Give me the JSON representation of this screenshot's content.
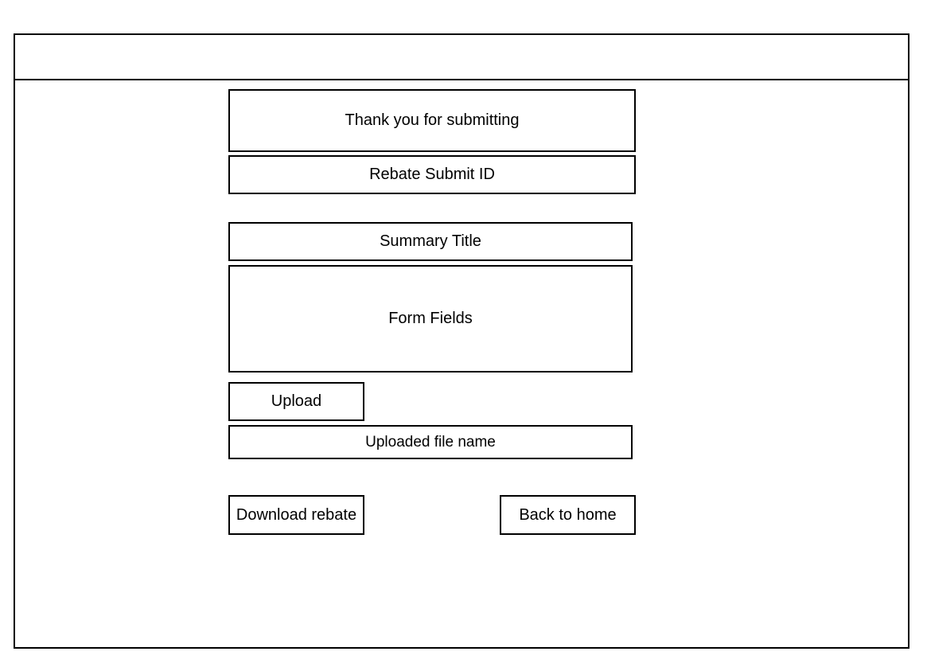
{
  "confirmation": {
    "thank_you_text": "Thank you for submitting",
    "rebate_submit_id_label": "Rebate Submit ID"
  },
  "summary": {
    "title": "Summary Title",
    "form_fields_placeholder": "Form Fields"
  },
  "upload": {
    "button_label": "Upload",
    "file_name_label": "Uploaded file name"
  },
  "actions": {
    "download_label": "Download rebate",
    "back_home_label": "Back to home"
  }
}
